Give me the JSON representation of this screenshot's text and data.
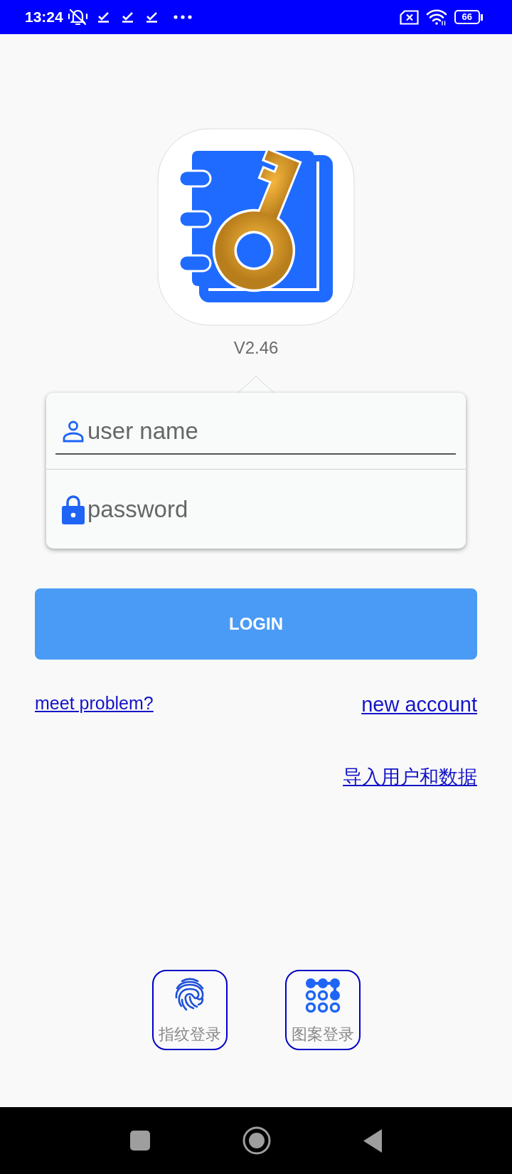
{
  "status_bar": {
    "time": "13:24",
    "battery": "66"
  },
  "app": {
    "version": "V2.46"
  },
  "login_form": {
    "username": {
      "placeholder": "user name"
    },
    "password": {
      "placeholder": "password"
    }
  },
  "login_button": {
    "label": "LOGIN"
  },
  "links": {
    "meet_problem": "meet problem?",
    "new_account": "new account",
    "import_data": "导入用户和数据"
  },
  "quick_login": [
    {
      "kind": "fingerprint",
      "label": "指纹登录"
    },
    {
      "kind": "pattern",
      "label": "图案登录"
    }
  ]
}
